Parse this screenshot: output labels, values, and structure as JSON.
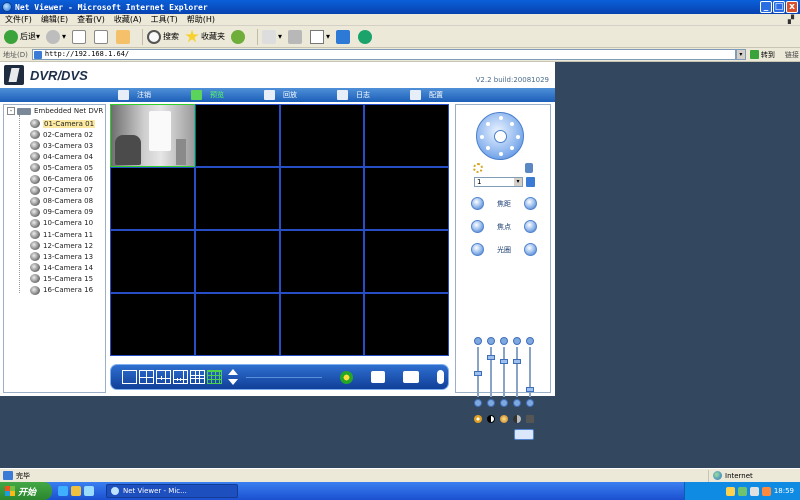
{
  "window": {
    "title": "Net Viewer - Microsoft Internet Explorer",
    "minimize": "_",
    "maximize": "□",
    "close": "x"
  },
  "menu": [
    "文件(F)",
    "编辑(E)",
    "查看(V)",
    "收藏(A)",
    "工具(T)",
    "帮助(H)"
  ],
  "toolbar": {
    "back": "后退",
    "search": "搜索",
    "favorites": "收藏夹"
  },
  "address": {
    "label": "地址(D)",
    "url": "http://192.168.1.64/",
    "go": "转到",
    "links": "链接"
  },
  "app": {
    "title": "DVR/DVS",
    "build": "V2.2  build:20081029",
    "nav": [
      "注销",
      "预览",
      "回放",
      "日志",
      "配置"
    ],
    "tree_root": "Embedded Net DVR",
    "cameras": [
      "01-Camera 01",
      "02-Camera 02",
      "03-Camera 03",
      "04-Camera 04",
      "05-Camera 05",
      "06-Camera 06",
      "07-Camera 07",
      "08-Camera 08",
      "09-Camera 09",
      "10-Camera 10",
      "11-Camera 11",
      "12-Camera 12",
      "13-Camera 13",
      "14-Camera 14",
      "15-Camera 15",
      "16-Camera 16"
    ],
    "ptz": {
      "preset_value": "1",
      "zoom": "焦距",
      "focus": "焦点",
      "iris": "光圈"
    }
  },
  "status": {
    "text": "完毕",
    "zone": "Internet"
  },
  "taskbar": {
    "start": "开始",
    "task": "Net Viewer - Mic...",
    "clock": "18:59"
  },
  "colors": {
    "app_bg": "#33485e",
    "nav_blue": "#1c5fb8",
    "grid_line": "#274ec4",
    "active_green": "#2fce2f"
  }
}
